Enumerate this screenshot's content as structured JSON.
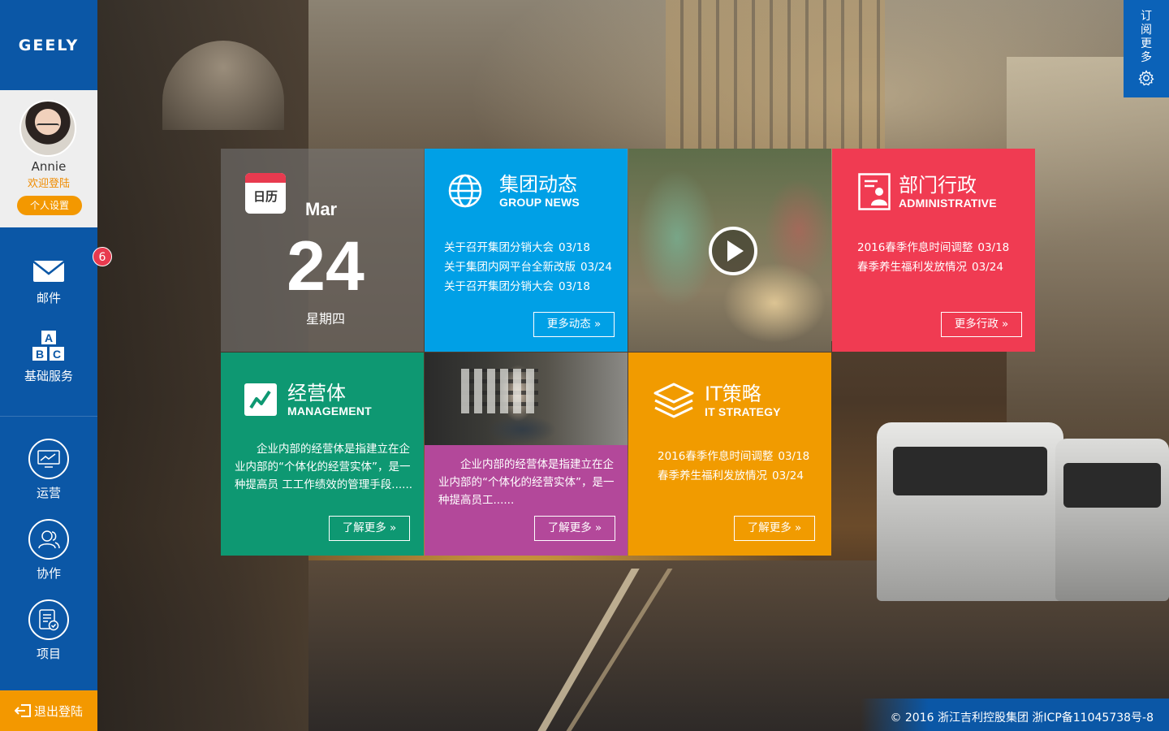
{
  "brand": {
    "logo": "GEELY"
  },
  "user": {
    "name": "Annie",
    "welcome": "欢迎登陆",
    "settings_label": "个人设置"
  },
  "sidebar": {
    "items": [
      {
        "label": "邮件",
        "icon": "mail-icon",
        "badge": "6"
      },
      {
        "label": "基础服务",
        "icon": "abc-blocks-icon"
      },
      {
        "label": "运营",
        "icon": "monitor-chart-icon"
      },
      {
        "label": "协作",
        "icon": "users-icon"
      },
      {
        "label": "项目",
        "icon": "clipboard-check-icon"
      }
    ],
    "logout_label": "退出登陆"
  },
  "subscribe": {
    "label": "订阅更多",
    "icon": "gear-icon"
  },
  "calendar": {
    "icon_label": "日历",
    "month": "Mar",
    "day": "24",
    "weekday": "星期四"
  },
  "group_news": {
    "title": "集团动态",
    "subtitle": "GROUP NEWS",
    "icon": "globe-icon",
    "items": [
      {
        "text": "关于召开集团分销大会",
        "date": "03/18"
      },
      {
        "text": "关于集团内网平台全新改版",
        "date": "03/24"
      },
      {
        "text": "关于召开集团分销大会",
        "date": "03/18"
      }
    ],
    "more_label": "更多动态"
  },
  "video": {
    "icon": "play-icon"
  },
  "administrative": {
    "title": "部门行政",
    "subtitle": "ADMINISTRATIVE",
    "icon": "id-card-icon",
    "items": [
      {
        "text": "2016春季作息时间调整",
        "date": "03/18"
      },
      {
        "text": "春季养生福利发放情况",
        "date": "03/24"
      }
    ],
    "more_label": "更多行政"
  },
  "management": {
    "title": "经营体",
    "subtitle": "MANAGEMENT",
    "icon": "trend-chart-icon",
    "description": "企业内部的经营体是指建立在企业内部的“个体化的经营实体”，是一种提高员 工工作绩效的管理手段......",
    "more_label": "了解更多"
  },
  "photo_tile": {
    "description": "企业内部的经营体是指建立在企业内部的“个体化的经营实体”，是一种提高员工......",
    "more_label": "了解更多"
  },
  "it_strategy": {
    "title": "IT策略",
    "subtitle": "IT STRATEGY",
    "icon": "layers-icon",
    "items": [
      {
        "text": "2016春季作息时间调整",
        "date": "03/18"
      },
      {
        "text": "春季养生福利发放情况",
        "date": "03/24"
      }
    ],
    "more_label": "了解更多"
  },
  "footer": {
    "copyright": "© 2016 浙江吉利控股集团 浙ICP备11045738号-8"
  },
  "colors": {
    "sidebar": "#0b57a6",
    "accent_orange": "#f39800",
    "news_blue": "#00a0e6",
    "admin_red": "#f03b52",
    "mgmt_green": "#0e9872",
    "photo_purple": "#b3489a",
    "it_orange": "#f19b00",
    "badge_red": "#e83a4f"
  }
}
